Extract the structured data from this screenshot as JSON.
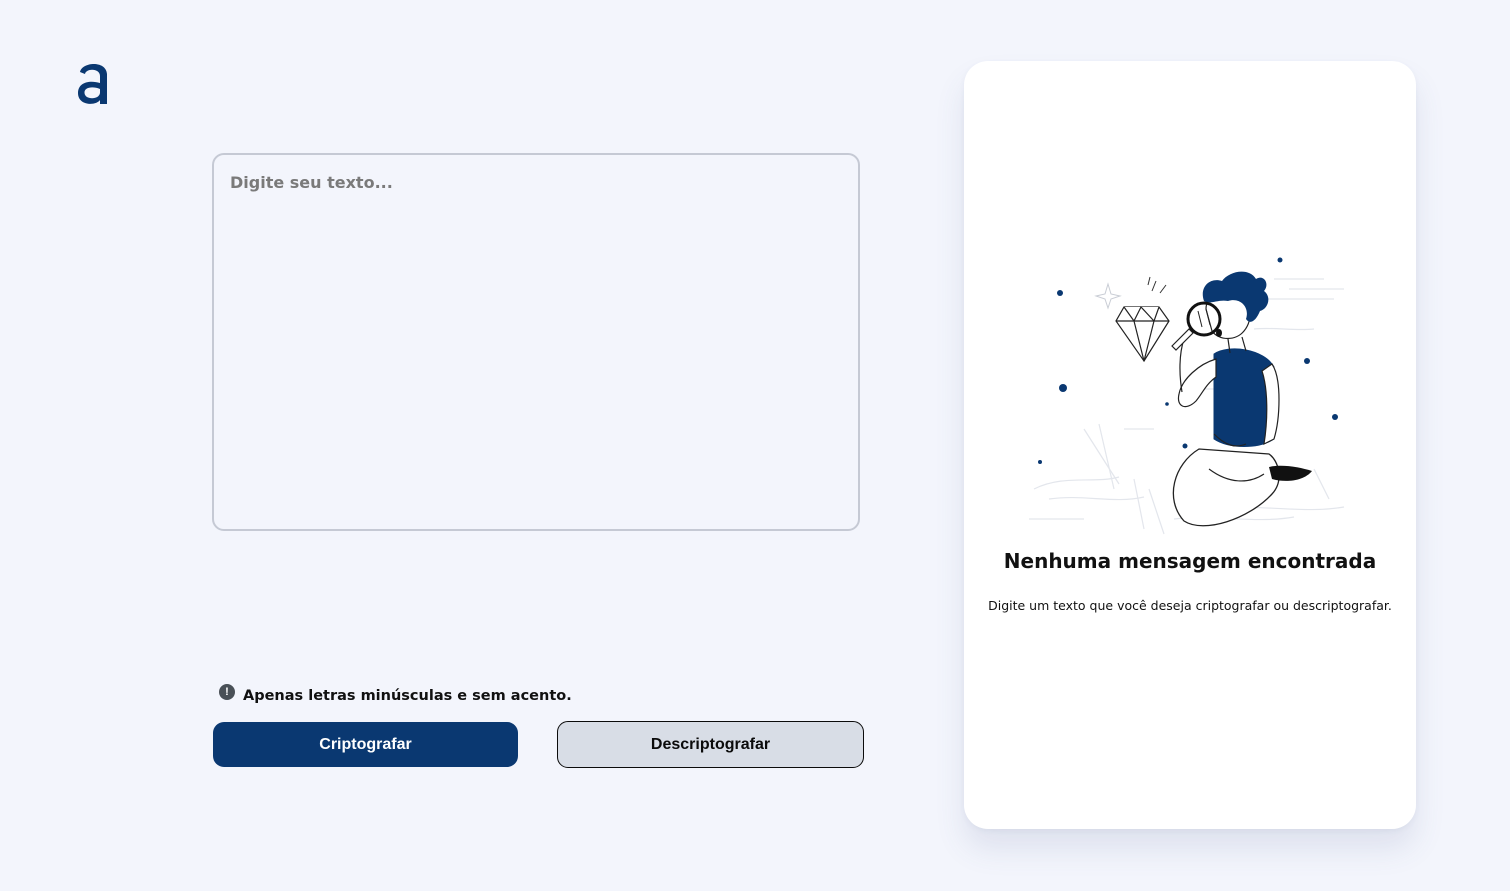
{
  "app": {
    "logo_icon": "alura-a-logo",
    "brand_color": "#0a3871"
  },
  "input": {
    "value": "",
    "placeholder": "Digite seu texto..."
  },
  "hint": {
    "icon": "exclamation-circle-icon",
    "text": "Apenas letras minúsculas e sem acento."
  },
  "buttons": {
    "encrypt_label": "Criptografar",
    "decrypt_label": "Descriptografar"
  },
  "result": {
    "illustration": "person-with-magnifying-glass-illustration",
    "title": "Nenhuma mensagem encontrada",
    "description": "Digite um texto que você deseja criptografar ou descriptografar."
  },
  "colors": {
    "background": "#f3f5fc",
    "primary": "#0a3871",
    "secondary_button": "#d8dde6",
    "panel": "#ffffff"
  }
}
